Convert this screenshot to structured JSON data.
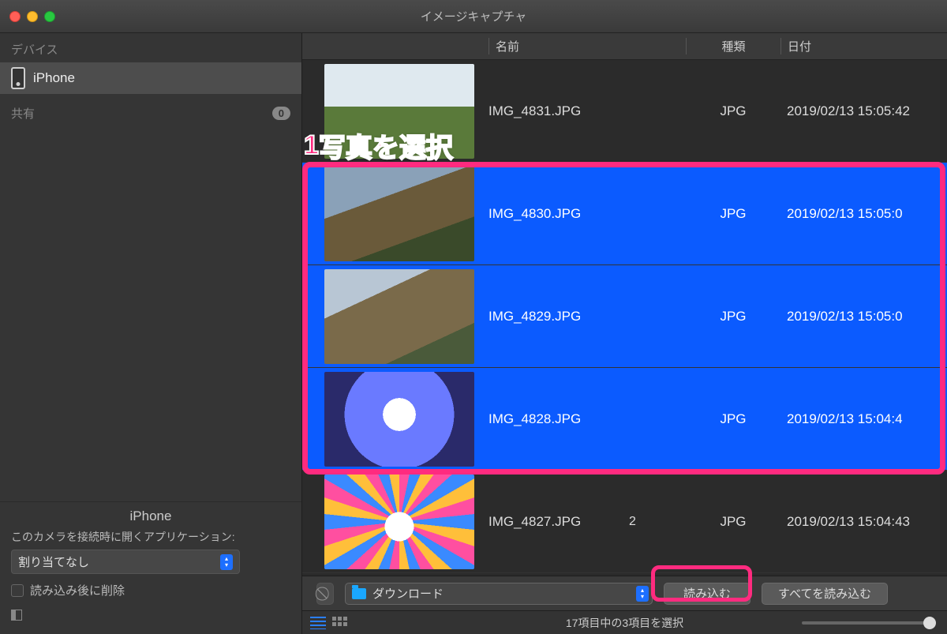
{
  "window": {
    "title": "イメージキャプチャ"
  },
  "sidebar": {
    "devices_header": "デバイス",
    "device_name": "iPhone",
    "share_header": "共有",
    "share_badge": "0",
    "bottom": {
      "device_title": "iPhone",
      "app_label": "このカメラを接続時に開くアプリケーション:",
      "app_select_value": "割り当てなし",
      "delete_after_import": "読み込み後に削除"
    }
  },
  "columns": {
    "name": "名前",
    "kind": "種類",
    "date": "日付"
  },
  "rows": [
    {
      "name": "IMG_4831.JPG",
      "kind": "JPG",
      "date": "2019/02/13 15:05:42",
      "selected": false,
      "thumb": "sky"
    },
    {
      "name": "IMG_4830.JPG",
      "kind": "JPG",
      "date": "2019/02/13 15:05:0",
      "selected": true,
      "thumb": "mtn1"
    },
    {
      "name": "IMG_4829.JPG",
      "kind": "JPG",
      "date": "2019/02/13 15:05:0",
      "selected": true,
      "thumb": "mtn2"
    },
    {
      "name": "IMG_4828.JPG",
      "kind": "JPG",
      "date": "2019/02/13 15:04:4",
      "selected": true,
      "thumb": "glass"
    },
    {
      "name": "IMG_4827.JPG",
      "kind": "JPG",
      "date": "2019/02/13 15:04:43",
      "selected": false,
      "thumb": "pattern"
    }
  ],
  "toolbar": {
    "destination": "ダウンロード",
    "import_btn": "読み込む",
    "import_all_btn": "すべてを読み込む"
  },
  "statusbar": {
    "text": "17項目中の3項目を選択"
  },
  "annotations": {
    "step1": "写真を選択",
    "step1_num": "1",
    "step2_num": "2"
  }
}
